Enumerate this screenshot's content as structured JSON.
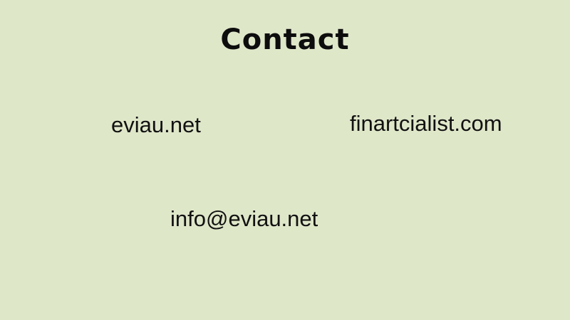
{
  "slide": {
    "title": "Contact",
    "links": {
      "eviau": "eviau.net",
      "finartcialist": "finartcialist.com",
      "email": "info@eviau.net"
    },
    "colors": {
      "background": "#dfe7c9",
      "text": "#0d0d0d"
    }
  }
}
